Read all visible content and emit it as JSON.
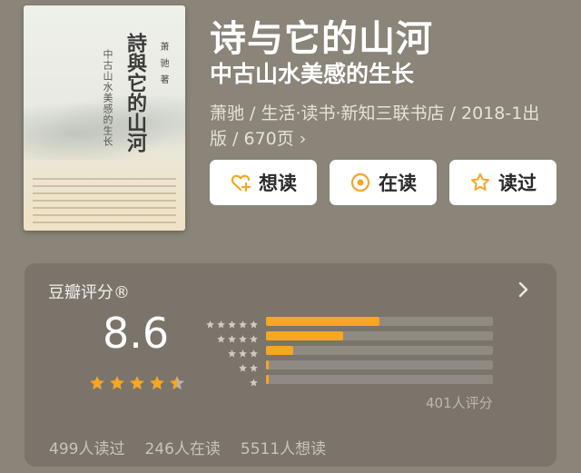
{
  "book": {
    "title": "诗与它的山河",
    "subtitle": "中古山水美感的生长",
    "meta_line1": "萧驰 / 生活·读书·新知三联书店 / 2018-1出",
    "meta_line2": "版 / 670页 ›"
  },
  "cover": {
    "calligraphy": "詩與它的山河",
    "subtitle": "中古山水美感的生长",
    "author": "萧驰著"
  },
  "actions": {
    "want": "想读",
    "reading": "在读",
    "read": "读过"
  },
  "rating": {
    "label": "豆瓣评分®",
    "score": "8.6",
    "stars_value": 4.5,
    "distribution": [
      {
        "stars": 5,
        "fraction": 0.5
      },
      {
        "stars": 4,
        "fraction": 0.34
      },
      {
        "stars": 3,
        "fraction": 0.12
      },
      {
        "stars": 2,
        "fraction": 0.01
      },
      {
        "stars": 1,
        "fraction": 0.01
      }
    ],
    "count": "401人评分"
  },
  "stats": {
    "read": "499人读过",
    "reading": "246人在读",
    "want": "5511人想读"
  },
  "colors": {
    "background": "#8a8479",
    "accent": "#f5a623",
    "button": "#ffffff"
  }
}
